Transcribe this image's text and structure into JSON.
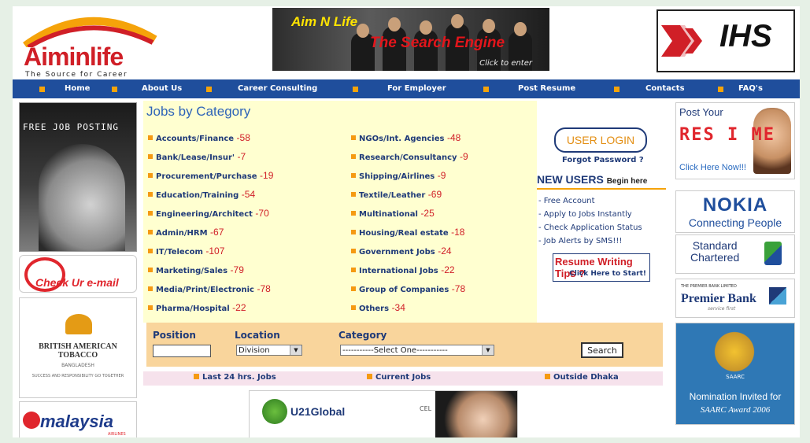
{
  "header": {
    "logo_text": "Aiminlife",
    "logo_tagline": "The Source for Career",
    "banner_line1": "Aim N Life",
    "banner_line2": "The Search Engine",
    "banner_enter": "Click to enter",
    "ihs_text": "IHS"
  },
  "nav": {
    "items": [
      "Home",
      "About Us",
      "Career Consulting",
      "For Employer",
      "Post Resume",
      "Contacts",
      "FAQ's"
    ]
  },
  "left": {
    "free_job_posting": "FREE JOB POSTING",
    "check_mail": "Check Ur e-mail",
    "bat_title": "BRITISH AMERICAN TOBACCO",
    "bat_sub": "BANGLADESH",
    "bat_small": "SUCCESS AND RESPONSIBILITY GO TOGETHER",
    "malaysia_text": "malaysia",
    "malaysia_sub": "AIRLINES"
  },
  "categories": {
    "title": "Jobs by Category",
    "left": [
      {
        "name": "Accounts/Finance",
        "count": "-58"
      },
      {
        "name": "Bank/Lease/Insur'",
        "count": "-7"
      },
      {
        "name": "Procurement/Purchase",
        "count": "-19"
      },
      {
        "name": "Education/Training",
        "count": "-54"
      },
      {
        "name": "Engineering/Architect",
        "count": "-70"
      },
      {
        "name": "Admin/HRM",
        "count": "-67"
      },
      {
        "name": "IT/Telecom",
        "count": "-107"
      },
      {
        "name": "Marketing/Sales",
        "count": "-79"
      },
      {
        "name": "Media/Print/Electronic",
        "count": "-78"
      },
      {
        "name": "Pharma/Hospital",
        "count": "-22"
      }
    ],
    "right": [
      {
        "name": "NGOs/Int. Agencies",
        "count": "-48"
      },
      {
        "name": "Research/Consultancy",
        "count": "-9"
      },
      {
        "name": "Shipping/Airlines",
        "count": "-9"
      },
      {
        "name": "Textile/Leather",
        "count": "-69"
      },
      {
        "name": "Multinational",
        "count": "-25"
      },
      {
        "name": "Housing/Real estate",
        "count": "-18"
      },
      {
        "name": "Government Jobs",
        "count": "-24"
      },
      {
        "name": "International Jobs",
        "count": "-22"
      },
      {
        "name": "Group of Companies",
        "count": "-78"
      },
      {
        "name": "Others",
        "count": "-34"
      }
    ]
  },
  "login": {
    "button": "USER LOGIN",
    "forgot": "Forgot Password ?",
    "new_users": "NEW USERS",
    "begin_here": "Begin here",
    "items": [
      "- Free Account",
      "- Apply to Jobs Instantly",
      "- Check Application Status",
      "- Job Alerts by SMS!!!"
    ],
    "resume_tips": "Resume Writing Tips ?",
    "resume_click": "Click Here to Start!"
  },
  "search": {
    "position_label": "Position",
    "location_label": "Location",
    "category_label": "Category",
    "position_value": "",
    "location_value": "Division",
    "category_value": "-----------Select One-----------",
    "button": "Search"
  },
  "quick_links": [
    "Last 24 hrs. Jobs",
    "Current Jobs",
    "Outside Dhaka"
  ],
  "bottom_banner": {
    "u21": "U21Global",
    "cel": "CEL"
  },
  "right": {
    "post_resume_title": "Post Your",
    "post_resume_big": "RES I ME",
    "post_resume_click": "Click Here Now!!!",
    "nokia": "NOKIA",
    "nokia_sub": "Connecting People",
    "sc_line1": "Standard",
    "sc_line2": "Chartered",
    "pb_small": "THE PREMIER BANK LIMITED",
    "pb_text": "Premier Bank",
    "pb_sub": "service first",
    "saarc_label": "SAARC",
    "saarc_title": "Nomination Invited for",
    "saarc_sub": "SAARC Award 2006"
  },
  "colors": {
    "nav_bg": "#1f4e9c",
    "accent_orange": "#f59a12",
    "brand_red": "#d01f27",
    "category_bg": "#ffffd0",
    "search_bg": "#f9d59c"
  }
}
